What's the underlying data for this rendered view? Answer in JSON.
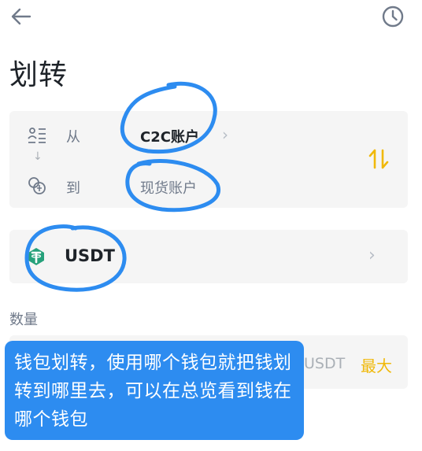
{
  "topbar": {
    "back_icon": "arrow-left-icon",
    "history_icon": "clock-icon"
  },
  "page": {
    "title": "划转"
  },
  "transfer": {
    "from_label": "从",
    "from_value": "C2C账户",
    "to_label": "到",
    "to_value": "现货账户",
    "swap_icon": "swap-vertical-icon"
  },
  "coin": {
    "name": "USDT",
    "icon": "tether-coin-icon"
  },
  "amount": {
    "label": "数量",
    "unit": "USDT",
    "max_label": "最大"
  },
  "annotation": {
    "note": "钱包划转，使用哪个钱包就把钱划转到哪里去，可以在总览看到钱在哪个钱包"
  },
  "colors": {
    "accent": "#f0b90b",
    "note_bg": "#2d8cf0",
    "circle_stroke": "#2d8cf0"
  }
}
